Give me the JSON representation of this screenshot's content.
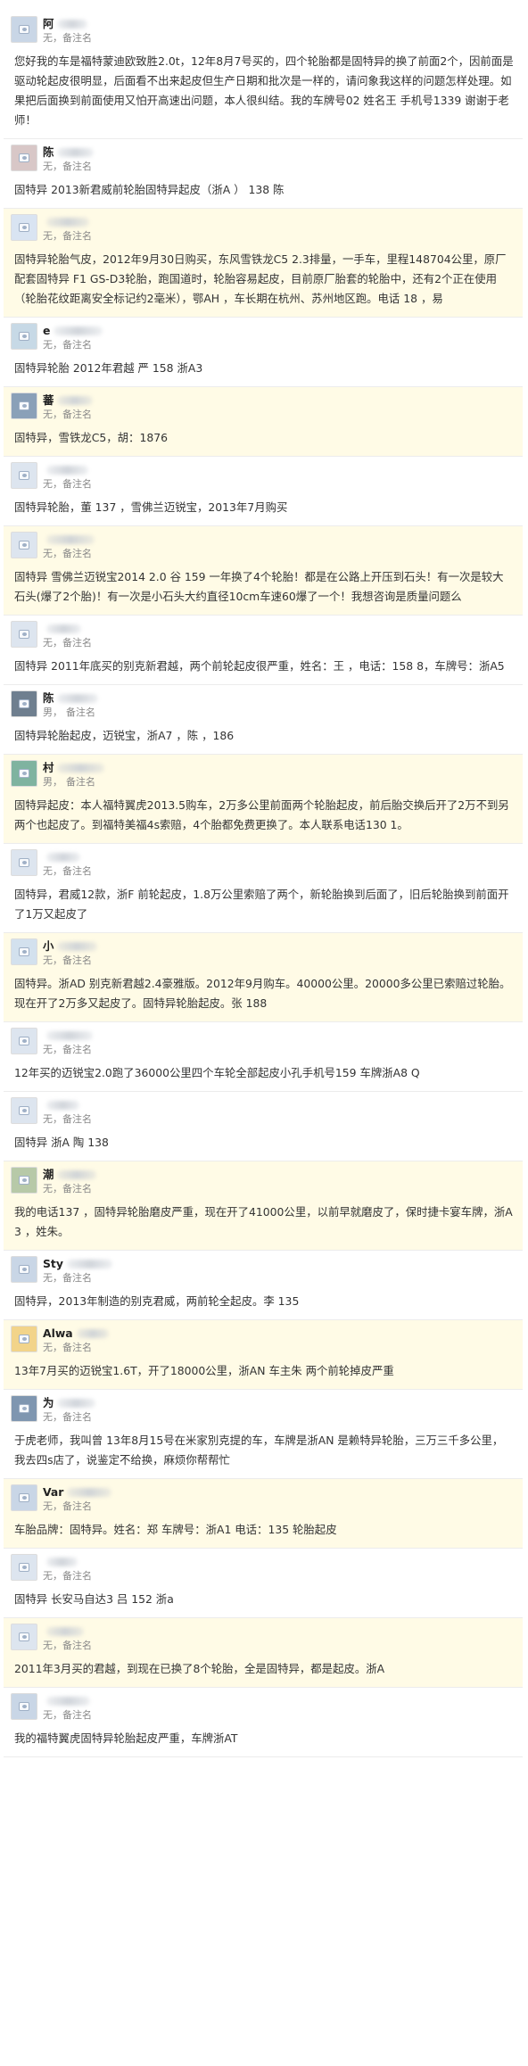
{
  "comments": [
    {
      "name": "阿",
      "gender": "",
      "note": "无，备注名",
      "text": "您好我的车是福特蒙迪欧致胜2.0t，12年8月7号买的，四个轮胎都是固特异的换了前面2个，因前面是驱动轮起皮很明显，后面看不出来起皮但生产日期和批次是一样的，请问象我这样的问题怎样处理。如果把后面换到前面使用又怕开高速出问题，本人很纠结。我的车牌号02 姓名王 手机号1339 谢谢于老师！"
    },
    {
      "name": "陈",
      "gender": "",
      "note": "无，备注名",
      "text": "固特异 2013新君威前轮胎固特异起皮（浙A ） 138 陈"
    },
    {
      "name": "",
      "gender": "",
      "note": "无，备注名",
      "text": "固特异轮胎气皮，2012年9月30日购买，东风雪铁龙C5 2.3排量，一手车，里程148704公里，原厂配套固特异 F1 GS-D3轮胎，跑国道时，轮胎容易起皮，目前原厂胎套的轮胎中，还有2个正在使用（轮胎花纹距离安全标记约2毫米），鄂AH ，车长期在杭州、苏州地区跑。电话 18 ，易"
    },
    {
      "name": "e",
      "gender": "",
      "note": "无，备注名",
      "text": "固特异轮胎 2012年君越 严 158 浙A3"
    },
    {
      "name": "蕃",
      "gender": "",
      "note": "无，备注名",
      "text": "固特异，雪铁龙C5，胡：1876"
    },
    {
      "name": "",
      "gender": "",
      "note": "无，备注名",
      "text": "固特异轮胎，董 137 ，雪佛兰迈锐宝，2013年7月购买"
    },
    {
      "name": "",
      "gender": "",
      "note": "无，备注名",
      "text": "固特异 雪佛兰迈锐宝2014 2.0 谷 159 一年换了4个轮胎！都是在公路上开压到石头！有一次是较大石头(爆了2个胎)！有一次是小石头大约直径10cm车速60爆了一个！我想咨询是质量问题么"
    },
    {
      "name": "",
      "gender": "",
      "note": "无，备注名",
      "text": "固特异 2011年底买的别克新君越，两个前轮起皮很严重，姓名：王 ，电话：158 8，车牌号：浙A5"
    },
    {
      "name": "陈",
      "gender": "男，",
      "note": "备注名",
      "text": "固特异轮胎起皮，迈锐宝，浙A7 ，陈 ，186"
    },
    {
      "name": "村",
      "gender": "男，",
      "note": "备注名",
      "text": "固特异起皮：本人福特翼虎2013.5购车，2万多公里前面两个轮胎起皮，前后胎交换后开了2万不到另两个也起皮了。到福特美福4s索赔，4个胎都免费更换了。本人联系电话130 1。"
    },
    {
      "name": "",
      "gender": "",
      "note": "无，备注名",
      "text": "固特异，君威12款，浙F 前轮起皮，1.8万公里索赔了两个，新轮胎换到后面了，旧后轮胎换到前面开了1万又起皮了"
    },
    {
      "name": "小",
      "gender": "",
      "note": "无，备注名",
      "text": "固特异。浙AD 别克新君越2.4豪雅版。2012年9月购车。40000公里。20000多公里已索赔过轮胎。现在开了2万多又起皮了。固特异轮胎起皮。张 188"
    },
    {
      "name": "",
      "gender": "",
      "note": "无，备注名",
      "text": "12年买的迈锐宝2.0跑了36000公里四个车轮全部起皮小孔手机号159 车牌浙A8 Q"
    },
    {
      "name": "",
      "gender": "",
      "note": "无，备注名",
      "text": "固特异 浙A 陶 138"
    },
    {
      "name": "潮",
      "gender": "",
      "note": "无，备注名",
      "text": "我的电话137 ，固特异轮胎磨皮严重，现在开了41000公里，以前早就磨皮了，保时捷卡宴车牌，浙A3 ，姓朱。"
    },
    {
      "name": "Sty",
      "gender": "",
      "note": "无，备注名",
      "text": "固特异，2013年制造的别克君威，两前轮全起皮。李 135"
    },
    {
      "name": "Alwa",
      "gender": "",
      "note": "无，备注名",
      "text": "13年7月买的迈锐宝1.6T，开了18000公里，浙AN 车主朱 两个前轮掉皮严重"
    },
    {
      "name": "为",
      "gender": "",
      "note": "无，备注名",
      "text": "于虎老师，我叫曾 13年8月15号在米家別克提的车，车牌是浙AN 是赖特异轮胎，三万三千多公里，我去四s店了，说鉴定不给换，麻烦你帮帮忙"
    },
    {
      "name": "Var",
      "gender": "",
      "note": "无，备注名",
      "text": "车胎品牌：固特异。姓名：郑 车牌号：浙A1 电话：135 轮胎起皮"
    },
    {
      "name": "",
      "gender": "",
      "note": "无，备注名",
      "text": "固特异 长安马自达3 吕 152 浙a"
    },
    {
      "name": "",
      "gender": "",
      "note": "无，备注名",
      "text": "2011年3月买的君越，到现在已换了8个轮胎，全是固特异，都是起皮。浙A"
    },
    {
      "name": "",
      "gender": "",
      "note": "无，备注名",
      "text": "我的福特翼虎固特异轮胎起皮严重，车牌浙AT"
    }
  ]
}
